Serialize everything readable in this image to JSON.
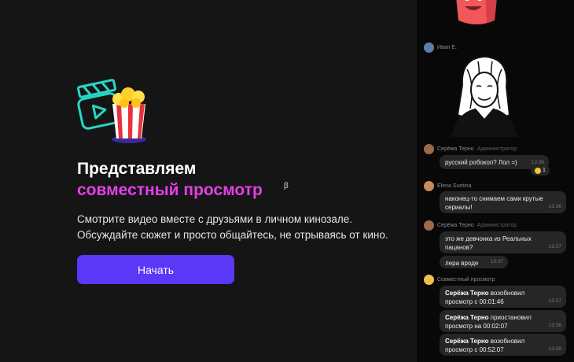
{
  "promo": {
    "title": "Представляем",
    "title_accent": "совместный просмотр",
    "beta": "β",
    "description": "Смотрите видео вместе с друзьями в личном кинозале. Обсуждайте сюжет и просто общайтесь, не отрываясь от кино.",
    "start_button": "Начать"
  },
  "chat": {
    "sticker_author": "Иван Е.",
    "messages": [
      {
        "author": "Серёжа Терно",
        "role": "Администратор",
        "text": "русский робокоп? Лол =)",
        "time": "13:36",
        "reaction_count": "1"
      },
      {
        "author": "Elena Suetina",
        "text": "наконец-то снимаем сами крутые сериалы!",
        "time": "13:36"
      },
      {
        "author": "Серёжа Терно",
        "role": "Администратор",
        "text": "это же девчонка из Реальных пацанов?",
        "time": "13:37"
      },
      {
        "text": "лера вроде",
        "time": "13:37"
      }
    ],
    "system_author": "Совместный просмотр",
    "system_events": [
      {
        "actor": "Серёжа Терно",
        "text": " возобновил просмотр с 00:01:46",
        "time": "13:37"
      },
      {
        "actor": "Серёжа Терно",
        "text": " приостановил просмотр на 00:02:07",
        "time": "13:38"
      },
      {
        "actor": "Серёжа Терно",
        "text": " возобновил просмотр с 00:52:07",
        "time": "13:39"
      }
    ]
  },
  "colors": {
    "accent": "#e53ee9",
    "button": "#5b37f7",
    "background": "#151515"
  }
}
